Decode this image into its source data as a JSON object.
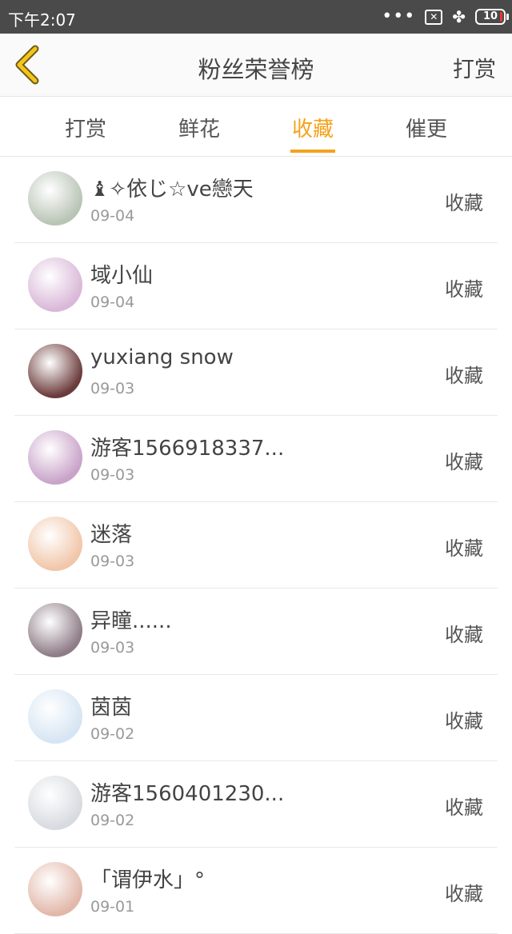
{
  "status_bar": {
    "time": "下午2:07",
    "dots": "•••",
    "box": "✕",
    "clover": "✤",
    "battery": "10"
  },
  "header": {
    "title": "粉丝荣誉榜",
    "right_label": "打赏"
  },
  "tabs": [
    {
      "label": "打赏"
    },
    {
      "label": "鲜花"
    },
    {
      "label": "收藏"
    },
    {
      "label": "催更"
    }
  ],
  "active_tab": 2,
  "accent_color": "#f5a21b",
  "fans": [
    {
      "name": "♝✧依じ☆ve戀天",
      "date": "09-04",
      "action": "收藏",
      "avatar_color": "#b9c4b5"
    },
    {
      "name": "域小仙",
      "date": "09-04",
      "action": "收藏",
      "avatar_color": "#d9b8d8"
    },
    {
      "name": "yuxiang snow",
      "date": "09-03",
      "action": "收藏",
      "avatar_color": "#6b3a3a"
    },
    {
      "name": "游客1566918337...",
      "date": "09-03",
      "action": "收藏",
      "avatar_color": "#c9a3c9"
    },
    {
      "name": "迷落",
      "date": "09-03",
      "action": "收藏",
      "avatar_color": "#f1c6a9"
    },
    {
      "name": "异瞳......",
      "date": "09-03",
      "action": "收藏",
      "avatar_color": "#8e7c86"
    },
    {
      "name": "茵茵",
      "date": "09-02",
      "action": "收藏",
      "avatar_color": "#d6e5f3"
    },
    {
      "name": "游客1560401230...",
      "date": "09-02",
      "action": "收藏",
      "avatar_color": "#d7dbe0"
    },
    {
      "name": "「谓伊水」°",
      "date": "09-01",
      "action": "收藏",
      "avatar_color": "#e2b7a9"
    }
  ]
}
